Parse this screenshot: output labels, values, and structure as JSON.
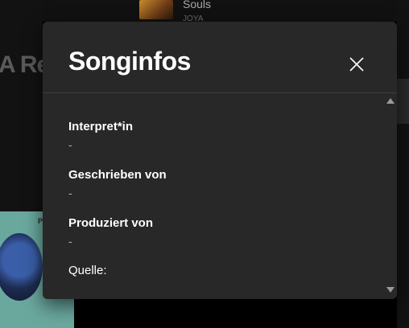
{
  "background": {
    "now_playing": {
      "title": "Souls",
      "artist": "JOYA"
    },
    "heading_fragment": "A Re",
    "card_letter": "P"
  },
  "dialog": {
    "title": "Songinfos",
    "fields": [
      {
        "label": "Interpret*in",
        "value": "-"
      },
      {
        "label": "Geschrieben von",
        "value": "-"
      },
      {
        "label": "Produziert von",
        "value": "-"
      }
    ],
    "source_label": "Quelle:"
  },
  "icons": {
    "close": "close-icon",
    "scroll_up": "scroll-up-arrow-icon",
    "scroll_down": "scroll-down-arrow-icon"
  },
  "colors": {
    "dialog_bg": "#282828",
    "page_bg": "#000000",
    "text_primary": "#ffffff",
    "text_secondary": "#b3b3b3"
  }
}
